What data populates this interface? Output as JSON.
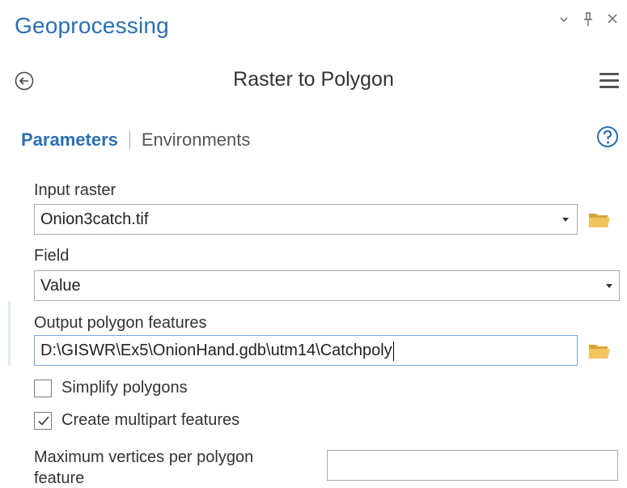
{
  "pane": {
    "title": "Geoprocessing",
    "controls": {
      "dropdown": "▾",
      "pin": "ꟼ",
      "close": "×"
    }
  },
  "tool": {
    "title": "Raster to Polygon",
    "back_icon": "back-circle-arrow-icon",
    "menu_icon": "hamburger-menu-icon"
  },
  "tabs": {
    "parameters": "Parameters",
    "environments": "Environments",
    "help_icon": "help-question-icon"
  },
  "params": {
    "input_raster": {
      "label": "Input raster",
      "value": "Onion3catch.tif"
    },
    "field": {
      "label": "Field",
      "value": "Value"
    },
    "output": {
      "label": "Output polygon features",
      "value": "D:\\GISWR\\Ex5\\OnionHand.gdb\\utm14\\Catchpoly"
    },
    "simplify": {
      "label": "Simplify polygons",
      "checked": false
    },
    "multipart": {
      "label": "Create multipart features",
      "checked": true
    },
    "max_vertices": {
      "label_line1": "Maximum vertices per polygon",
      "label_line2": "feature",
      "value": ""
    }
  },
  "colors": {
    "accent": "#2b6fb2",
    "folder": "#e8b84a",
    "border": "#a9a9a9"
  }
}
